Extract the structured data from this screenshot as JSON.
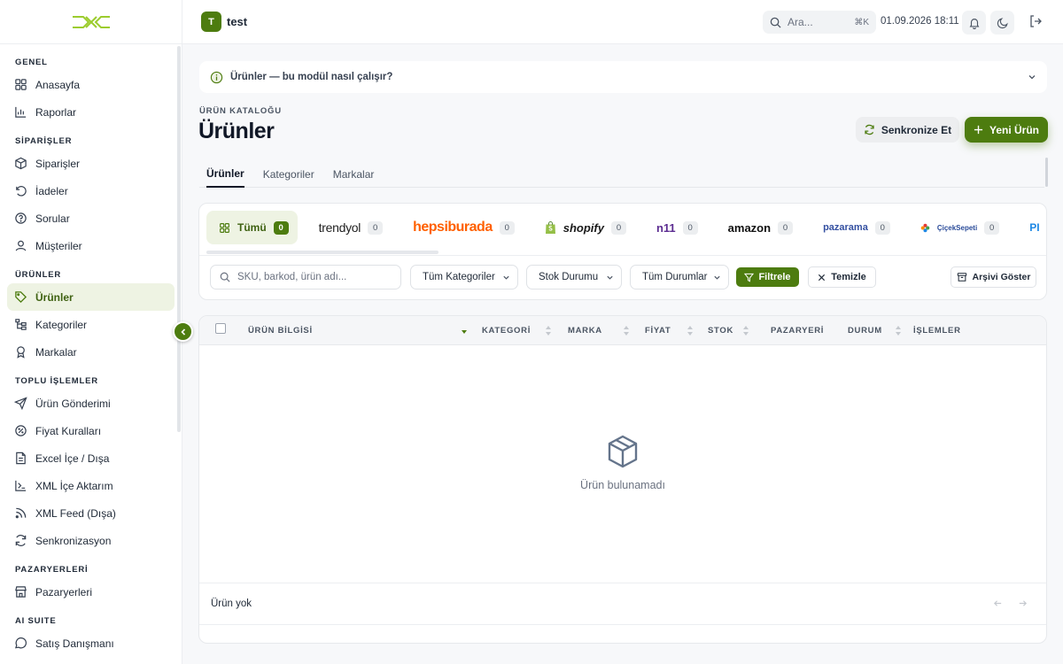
{
  "topbar": {
    "workspace_initial": "T",
    "workspace_name": "test",
    "search_placeholder": "Ara...",
    "search_shortcut": "⌘K",
    "datetime": "01.09.2026 18:11"
  },
  "sidebar": {
    "sections": [
      {
        "title": "GENEL",
        "items": [
          {
            "label": "Anasayfa",
            "icon": "grid-icon"
          },
          {
            "label": "Raporlar",
            "icon": "bar-chart-icon"
          }
        ]
      },
      {
        "title": "SİPARİŞLER",
        "items": [
          {
            "label": "Siparişler",
            "icon": "package-icon"
          },
          {
            "label": "İadeler",
            "icon": "rotate-ccw-icon"
          },
          {
            "label": "Sorular",
            "icon": "help-circle-icon"
          },
          {
            "label": "Müşteriler",
            "icon": "user-icon"
          }
        ]
      },
      {
        "title": "ÜRÜNLER",
        "items": [
          {
            "label": "Ürünler",
            "icon": "tag-icon",
            "active": true
          },
          {
            "label": "Kategoriler",
            "icon": "tree-icon"
          },
          {
            "label": "Markalar",
            "icon": "award-icon"
          }
        ]
      },
      {
        "title": "TOPLU İŞLEMLER",
        "items": [
          {
            "label": "Ürün Gönderimi",
            "icon": "send-icon"
          },
          {
            "label": "Fiyat Kuralları",
            "icon": "percent-icon"
          },
          {
            "label": "Excel İçe / Dışa",
            "icon": "file-icon"
          },
          {
            "label": "XML İçe Aktarım",
            "icon": "code-icon"
          },
          {
            "label": "XML Feed (Dışa)",
            "icon": "rss-icon"
          },
          {
            "label": "Senkronizasyon",
            "icon": "refresh-icon"
          }
        ]
      },
      {
        "title": "PAZARYERLERİ",
        "items": [
          {
            "label": "Pazaryerleri",
            "icon": "store-icon"
          }
        ]
      },
      {
        "title": "AI SUITE",
        "items": [
          {
            "label": "Satış Danışmanı",
            "icon": "message-icon"
          }
        ]
      }
    ]
  },
  "help": {
    "text": "Ürünler — bu modül nasıl çalışır?"
  },
  "page": {
    "eyebrow": "ÜRÜN KATALOĞU",
    "title": "Ürünler",
    "sync_label": "Senkronize Et",
    "new_label": "Yeni Ürün"
  },
  "tabs": [
    "Ürünler",
    "Kategoriler",
    "Markalar"
  ],
  "marketplaces": {
    "all_label": "Tümü",
    "all_count": "0",
    "items": [
      {
        "name": "trendyol",
        "count": "0"
      },
      {
        "name": "hepsiburada",
        "count": "0"
      },
      {
        "name": "shopify",
        "count": "0"
      },
      {
        "name": "n11",
        "count": "0"
      },
      {
        "name": "amazon",
        "count": "0"
      },
      {
        "name": "pazarama",
        "count": "0"
      },
      {
        "name": "ÇiçekSepeti",
        "count": "0"
      },
      {
        "name": "PI",
        "count": ""
      }
    ]
  },
  "filters": {
    "search_placeholder": "SKU, barkod, ürün adı...",
    "category": "Tüm Kategoriler",
    "stock": "Stok Durumu",
    "status": "Tüm Durumlar",
    "filter_label": "Filtrele",
    "clear_label": "Temizle",
    "archive_label": "Arşivi Göster"
  },
  "table": {
    "columns": [
      "ÜRÜN BİLGİSİ",
      "KATEGORİ",
      "MARKA",
      "FİYAT",
      "STOK",
      "PAZARYERİ",
      "DURUM",
      "İŞLEMLER"
    ],
    "empty_text": "Ürün bulunamadı",
    "footer_text": "Ürün yok"
  },
  "colors": {
    "accent": "#4d7c0f",
    "accent_soft": "#eef3e3",
    "hepsiburada": "#ff6000"
  }
}
